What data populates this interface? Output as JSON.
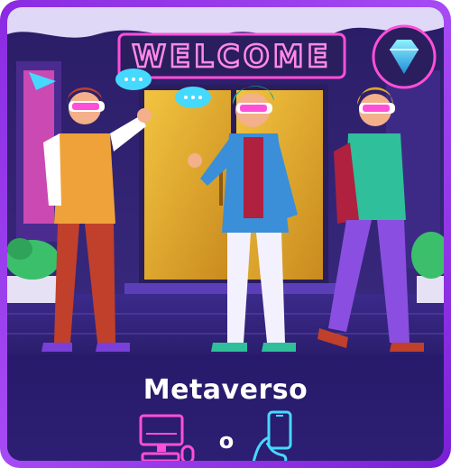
{
  "banner": {
    "sign_text": "WELCOME",
    "title": "Metaverso",
    "or_label": "o",
    "devices": [
      "computer-icon",
      "smartphone-icon"
    ]
  },
  "colors": {
    "frame": "#9b3cf0",
    "background": "#1c1450",
    "neon_pink": "#ff4fd8",
    "neon_cyan": "#46d9ff",
    "door_gold": "#e0a52a"
  }
}
